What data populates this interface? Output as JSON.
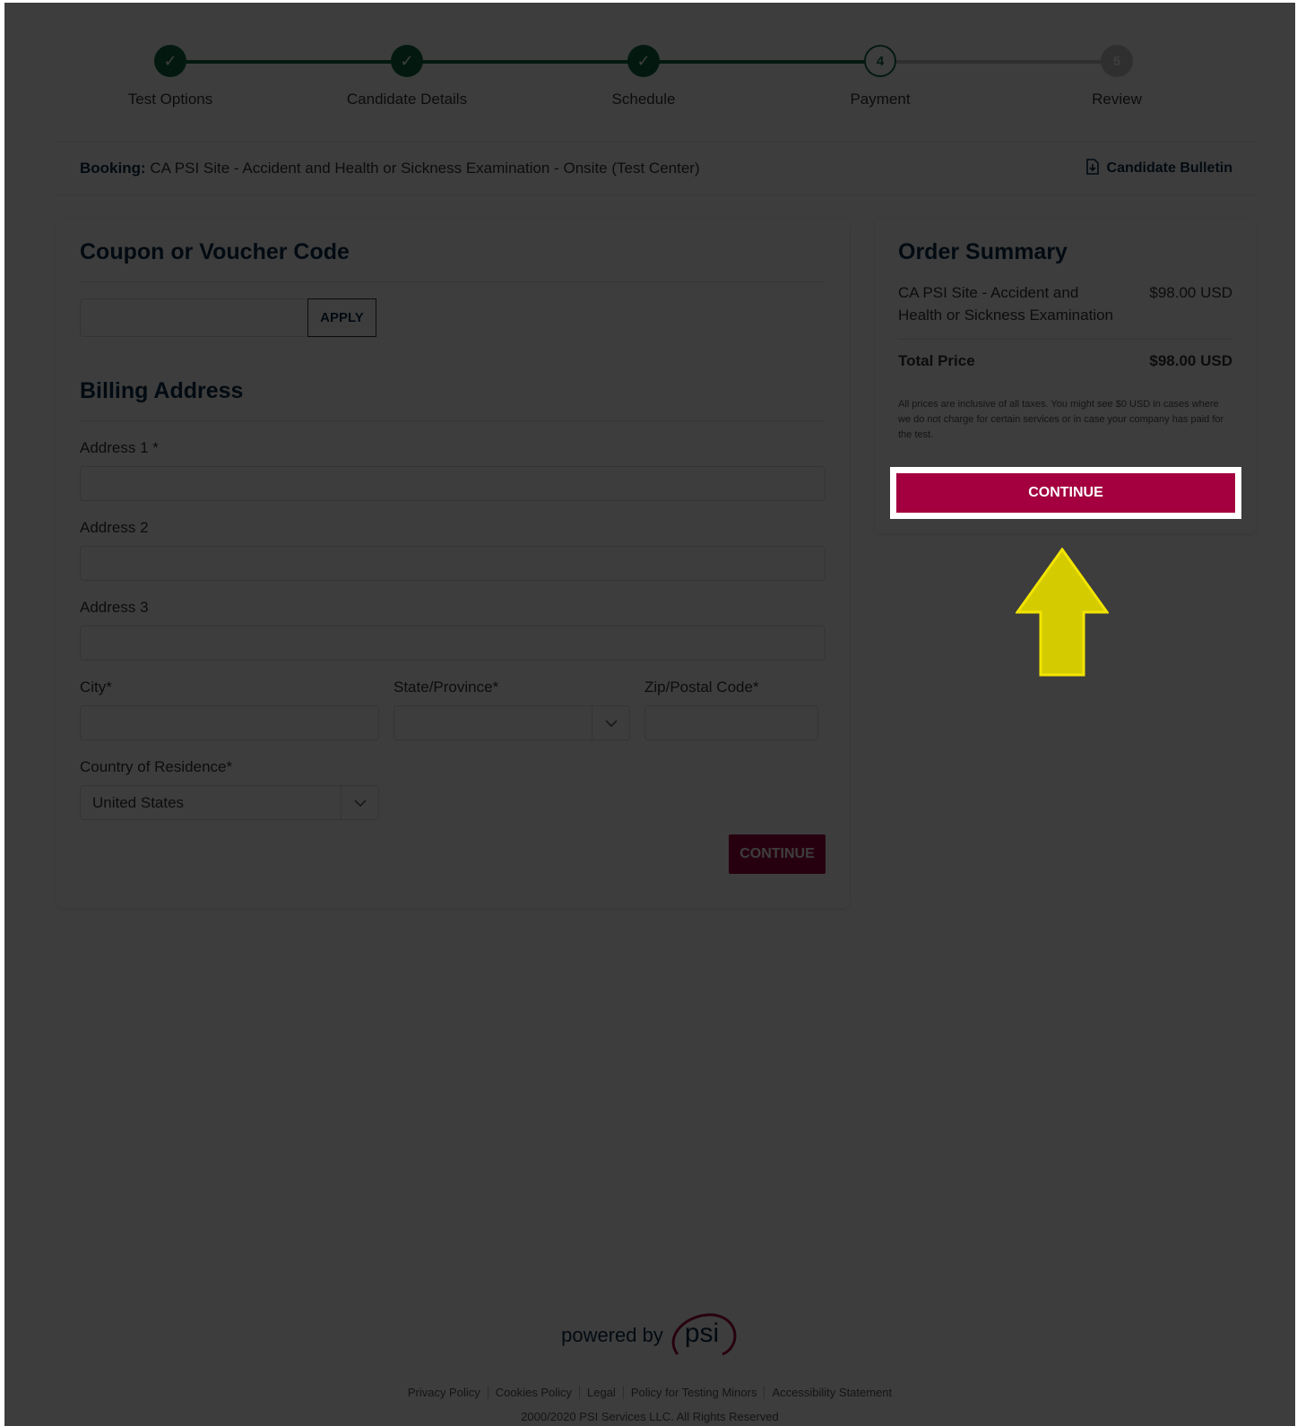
{
  "stepper": {
    "steps": [
      {
        "label": "Test Options",
        "state": "done",
        "mark": "✓"
      },
      {
        "label": "Candidate Details",
        "state": "done",
        "mark": "✓"
      },
      {
        "label": "Schedule",
        "state": "done",
        "mark": "✓"
      },
      {
        "label": "Payment",
        "state": "current",
        "mark": "4"
      },
      {
        "label": "Review",
        "state": "todo",
        "mark": "5"
      }
    ]
  },
  "booking": {
    "prefix": "Booking:",
    "text": "CA PSI Site - Accident and Health or Sickness Examination - Onsite (Test Center)",
    "bulletin_label": "Candidate Bulletin"
  },
  "coupon": {
    "title": "Coupon or Voucher Code",
    "input_value": "",
    "apply_label": "APPLY"
  },
  "billing": {
    "title": "Billing Address",
    "address1_label": "Address 1",
    "address2_label": "Address 2",
    "address3_label": "Address 3",
    "city_label": "City",
    "state_label": "State/Province",
    "zip_label": "Zip/Postal Code",
    "country_label": "Country of Residence",
    "country_value": "United States",
    "required_mark": "*",
    "continue_label": "CONTINUE"
  },
  "order": {
    "title": "Order Summary",
    "item_name": "CA PSI Site - Accident and Health or Sickness Examination",
    "item_price": "$98.00 USD",
    "total_label": "Total Price",
    "total_value": "$98.00 USD",
    "note": "All prices are inclusive of all taxes. You might see $0 USD in cases where we do not charge for certain services or in case your company has paid for the test.",
    "continue_label": "CONTINUE"
  },
  "footer": {
    "powered_by": "powered by",
    "logo_text": "psi",
    "links": [
      "Privacy Policy",
      "Cookies Policy",
      "Legal",
      "Policy for Testing Minors",
      "Accessibility Statement"
    ],
    "copyright": "2000/2020 PSI Services LLC. All Rights Reserved"
  },
  "colors": {
    "brand_primary": "#a4003f",
    "step_done": "#0e6b45",
    "heading": "#0a2a4a",
    "highlight_arrow": "#f2e400"
  },
  "icons": {
    "bulletin": "document-download-icon",
    "select": "chevron-down-icon",
    "pointer": "up-arrow-icon"
  }
}
